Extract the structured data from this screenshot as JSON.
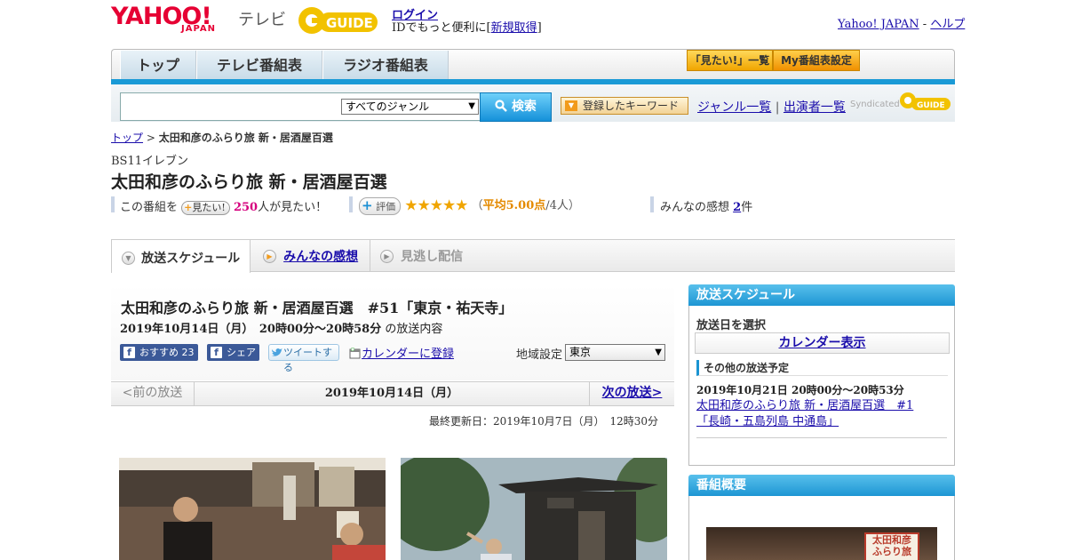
{
  "header": {
    "logo_main": "YAHOO!",
    "logo_sub": "JAPAN",
    "logo_tv": "テレビ",
    "gguide_text": "GUIDE",
    "login_label": "ログイン",
    "login_sub_prefix": "IDでもっと便利に[",
    "register_label": "新規取得",
    "login_sub_suffix": "]",
    "yahoo_japan_link": "Yahoo! JAPAN",
    "separator": "-",
    "help_link": "ヘルプ"
  },
  "nav": {
    "tabs": [
      "トップ",
      "テレビ番組表",
      "ラジオ番組表"
    ],
    "mitai_list": "「見たい!」一覧",
    "my_schedule": "My番組表設定"
  },
  "search": {
    "genre_selected": "すべてのジャンル",
    "button_label": "検索",
    "keyword_button": "登録したキーワード",
    "genre_list": "ジャンル一覧",
    "divider": "|",
    "performer_list": "出演者一覧",
    "syndicated": "Syndicated"
  },
  "breadcrumb": {
    "home": "トップ",
    "sep": ">",
    "current": "太田和彦のふらり旅 新・居酒屋百選"
  },
  "program": {
    "channel": "BS11イレブン",
    "title": "太田和彦のふらり旅 新・居酒屋百選",
    "mitai_prefix": "この番組を",
    "mitai_button": "見たい!",
    "mitai_count": "250",
    "mitai_suffix": "人が見たい！",
    "eval_button": "評価",
    "rating_stars": 5,
    "rating_open": "（",
    "rating_avg": "平均5.00点",
    "rating_people": "/4人",
    "rating_close": "）",
    "comments_label": "みんなの感想",
    "comments_count": "2",
    "comments_suffix": "件"
  },
  "tabs": [
    {
      "label": "放送スケジュール"
    },
    {
      "label": "みんなの感想"
    },
    {
      "label": "見逃し配信"
    }
  ],
  "episode": {
    "title": "太田和彦のふらり旅 新・居酒屋百選　#51「東京・祐天寺」",
    "date_time": "2019年10月14日（月）　20時00分～20時58分",
    "date_suffix": "の放送内容",
    "fb_recommend": "おすすめ",
    "fb_count": "23",
    "fb_share": "シェア",
    "tweet": "ツイートする",
    "calendar_register": "カレンダーに登録",
    "region_label": "地域設定",
    "region_selected": "東京"
  },
  "pager": {
    "prev": "<前の放送",
    "current": "2019年10月14日（月）",
    "next": "次の放送>"
  },
  "last_updated": "最終更新日：2019年10月7日（月）　12時30分",
  "sidebar": {
    "schedule_head": "放送スケジュール",
    "choose_date": "放送日を選択",
    "calendar_button": "カレンダー表示",
    "other_head": "その他の放送予定",
    "other_date": "2019年10月21日  20時00分～20時53分",
    "other_link": "太田和彦のふらり旅 新・居酒屋百選　#1「長崎・五島列島 中通島」",
    "overview_head": "番組概要",
    "overview_sign": "太田和彦 ふらり旅"
  }
}
